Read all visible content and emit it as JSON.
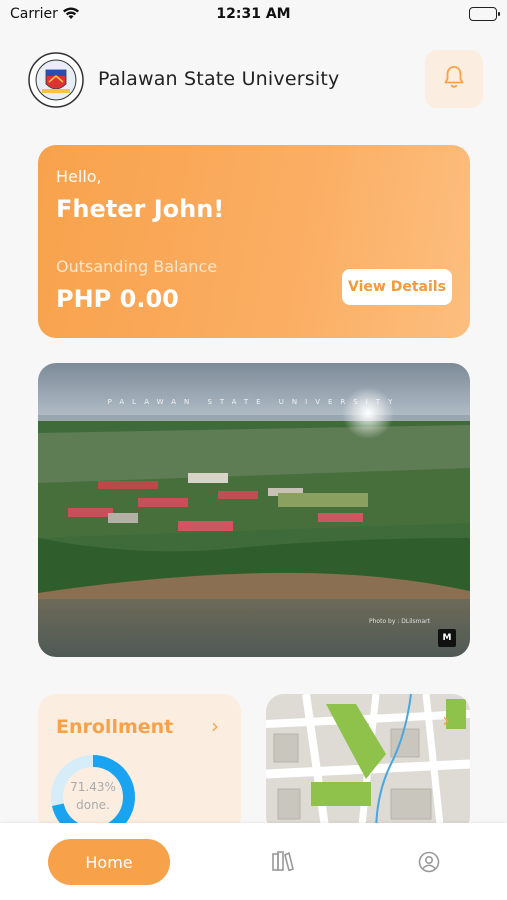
{
  "status_bar": {
    "carrier": "Carrier",
    "time": "12:31 AM"
  },
  "header": {
    "university_name": "Palawan State University",
    "logo_text_top": "PALAWAN STATE UNIVERSITY",
    "logo_text_bottom": "PHILIPPINES",
    "logo_icon": "university-seal-icon",
    "notification_icon": "bell-icon"
  },
  "balance_card": {
    "greeting": "Hello,",
    "name": "Fheter John!",
    "balance_label": "Outsanding Balance",
    "balance_value": "PHP 0.00",
    "view_button": "View Details"
  },
  "photo_card": {
    "caption": "PALAWAN STATE UNIVERSITY",
    "credit": "Photo by : DLilsmart",
    "badge": "M"
  },
  "enrollment_card": {
    "title": "Enrollment",
    "arrow": "›",
    "progress_percent": 71.43,
    "progress_label": "71.43%",
    "progress_sub": "done."
  },
  "map_card": {
    "arrow": "›",
    "icon": "map-icon"
  },
  "bottom_nav": {
    "home_label": "Home",
    "books_icon": "books-icon",
    "profile_icon": "profile-icon"
  },
  "colors": {
    "accent": "#f7a24b",
    "card_bg": "#fbeee0",
    "donut_fill": "#1aa3f0",
    "donut_track": "#d6ecf9"
  }
}
